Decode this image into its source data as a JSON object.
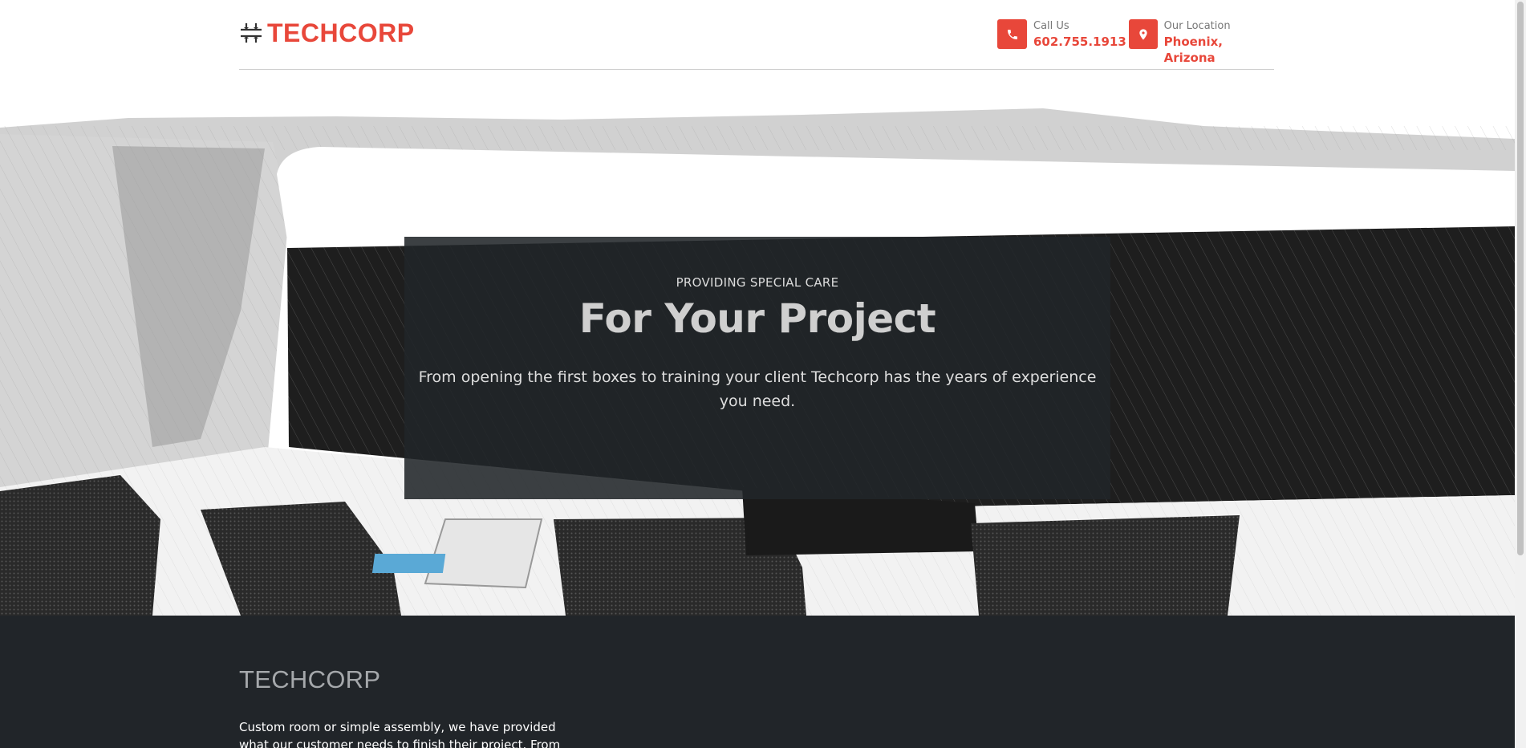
{
  "header": {
    "logo_text": "TECHCORP",
    "call": {
      "label": "Call Us",
      "value": "602.755.1913",
      "icon": "phone-icon"
    },
    "location": {
      "label": "Our Location",
      "value": "Phoenix, Arizona",
      "icon": "map-pin-icon"
    }
  },
  "hero": {
    "eyebrow": "PROVIDING SPECIAL CARE",
    "title": "For Your Project",
    "description": "From opening the first boxes to training your client Techcorp has the years of experience you need."
  },
  "about": {
    "title": "TECHCORP",
    "text": "Custom room or simple assembly, we have provided what our customer needs to finish their project. From"
  },
  "colors": {
    "accent": "#e8473a",
    "dark": "#212529"
  }
}
